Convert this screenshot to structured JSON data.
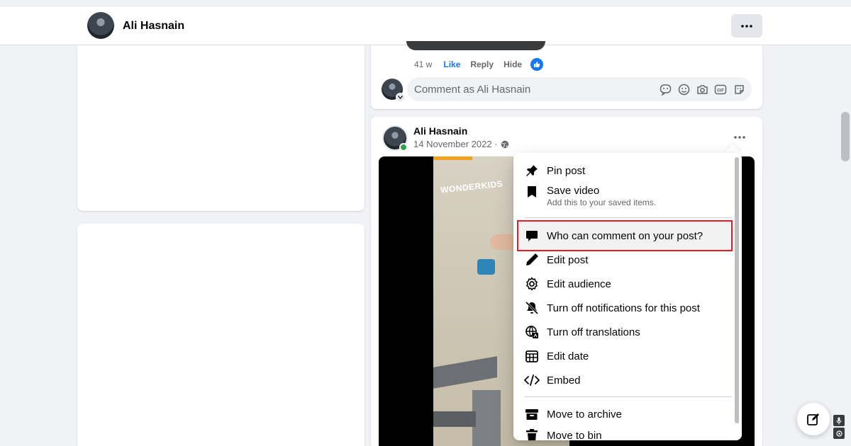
{
  "header": {
    "user_name": "Ali Hasnain",
    "more_icon": "more-horizontal-icon"
  },
  "prev_comment": {
    "time": "41 w",
    "like_label": "Like",
    "reply_label": "Reply",
    "hide_label": "Hide",
    "reaction_icon": "thumbs-up-icon"
  },
  "comment_composer": {
    "placeholder": "Comment as Ali Hasnain",
    "icons": [
      "sticker-icon",
      "emoji-icon",
      "camera-icon",
      "gif-icon",
      "avatar-sticker-icon"
    ]
  },
  "post": {
    "author": "Ali Hasnain",
    "date": "14 November 2022 ·",
    "audience_icon": "globe-icon",
    "video_overlay_text": "WONDERKIDS"
  },
  "menu": {
    "items": [
      {
        "label": "Pin post",
        "icon": "pin-icon"
      },
      {
        "label": "Save video",
        "sub": "Add this to your saved items.",
        "icon": "bookmark-icon"
      },
      {
        "label": "Who can comment on your post?",
        "icon": "comment-icon",
        "highlighted": true
      },
      {
        "label": "Edit post",
        "icon": "pencil-icon"
      },
      {
        "label": "Edit audience",
        "icon": "gear-icon"
      },
      {
        "label": "Turn off notifications for this post",
        "icon": "bell-off-icon"
      },
      {
        "label": "Turn off translations",
        "icon": "translate-globe-icon"
      },
      {
        "label": "Edit date",
        "icon": "calendar-icon"
      },
      {
        "label": "Embed",
        "icon": "code-icon"
      },
      {
        "label": "Move to archive",
        "icon": "archive-icon"
      },
      {
        "label": "Move to bin",
        "icon": "trash-icon"
      }
    ],
    "highlight_color": "#e41c23"
  },
  "colors": {
    "link_blue": "#1877f2",
    "online_green": "#31a24c",
    "page_bg": "#f0f2f5"
  }
}
